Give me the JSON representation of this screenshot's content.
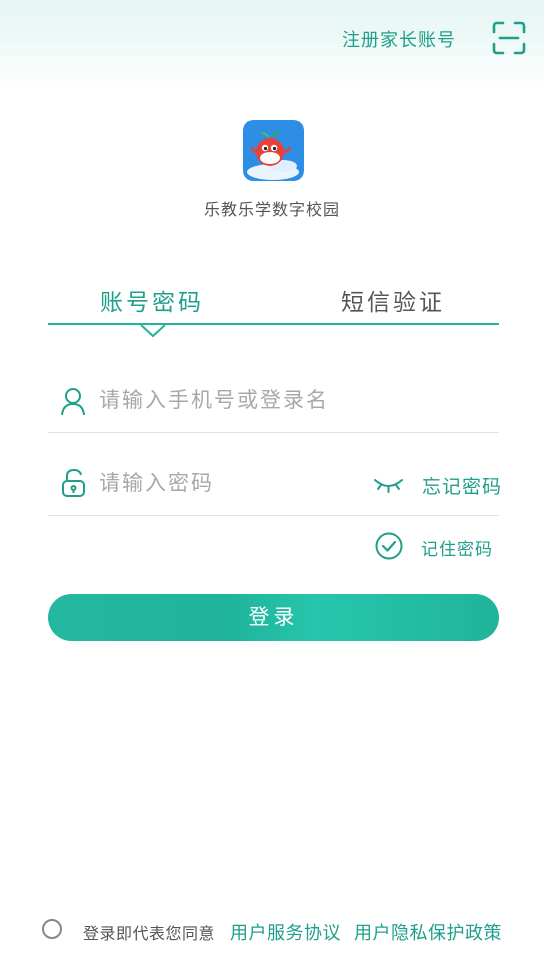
{
  "header": {
    "register_label": "注册家长账号",
    "scan_icon": "scan-icon"
  },
  "app": {
    "name": "乐教乐学数字校园",
    "logo_icon": "app-logo"
  },
  "tabs": [
    {
      "label": "账号密码",
      "active": true
    },
    {
      "label": "短信验证",
      "active": false
    }
  ],
  "form": {
    "username": {
      "value": "",
      "placeholder": "请输入手机号或登录名",
      "icon": "user-icon"
    },
    "password": {
      "value": "",
      "placeholder": "请输入密码",
      "icon": "lock-icon"
    },
    "eye_icon": "eye-closed-icon",
    "forgot_label": "忘记密码",
    "remember_label": "记住密码",
    "remember_checked": true,
    "login_label": "登录"
  },
  "agreement": {
    "checked": false,
    "text": "登录即代表您同意",
    "service_link": "用户服务协议",
    "privacy_link": "用户隐私保护政策"
  },
  "colors": {
    "accent": "#1f9f8b",
    "button": "#1fb49b",
    "background": "#ffffff"
  }
}
